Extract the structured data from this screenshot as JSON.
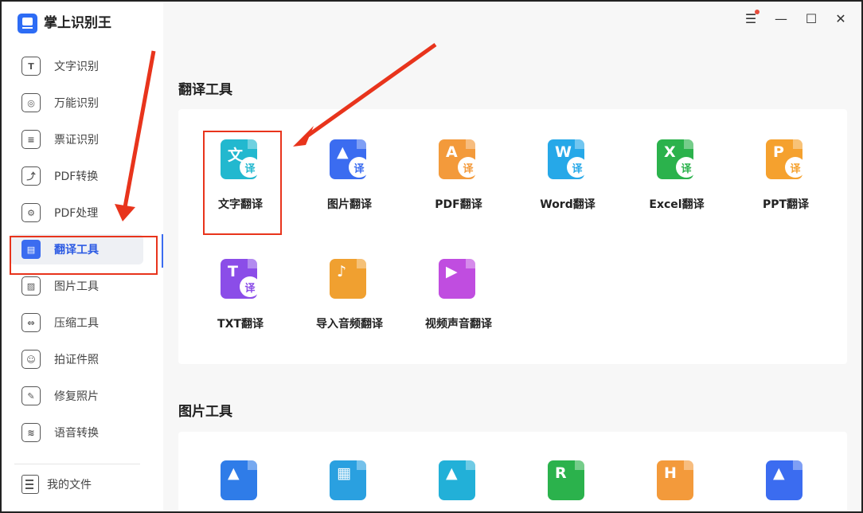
{
  "app": {
    "title": "掌上识别王"
  },
  "sidebar": {
    "items": [
      {
        "label": "文字识别",
        "icon": "text-recognition-icon",
        "glyph": "T"
      },
      {
        "label": "万能识别",
        "icon": "universal-recognition-icon",
        "glyph": "◎"
      },
      {
        "label": "票证识别",
        "icon": "ticket-recognition-icon",
        "glyph": "≡"
      },
      {
        "label": "PDF转换",
        "icon": "pdf-convert-icon",
        "glyph": "⤴"
      },
      {
        "label": "PDF处理",
        "icon": "pdf-process-icon",
        "glyph": "⚙"
      },
      {
        "label": "翻译工具",
        "icon": "translate-tool-icon",
        "glyph": "▤",
        "active": true
      },
      {
        "label": "图片工具",
        "icon": "image-tool-icon",
        "glyph": "▨"
      },
      {
        "label": "压缩工具",
        "icon": "compress-tool-icon",
        "glyph": "⇔"
      },
      {
        "label": "拍证件照",
        "icon": "id-photo-icon",
        "glyph": "☺"
      },
      {
        "label": "修复照片",
        "icon": "repair-photo-icon",
        "glyph": "✎"
      },
      {
        "label": "语音转换",
        "icon": "voice-convert-icon",
        "glyph": "≋"
      }
    ],
    "my_files": "我的文件"
  },
  "window_controls": {
    "menu": "☰",
    "minimize": "—",
    "maximize": "☐",
    "close": "✕"
  },
  "sections": {
    "translate": {
      "title": "翻译工具",
      "tools": [
        {
          "name": "文字翻译",
          "symbol": "文",
          "color": "#22b8cf",
          "badge": "译"
        },
        {
          "name": "图片翻译",
          "symbol": "▲",
          "color": "#3b6cf0",
          "badge": "译"
        },
        {
          "name": "PDF翻译",
          "symbol": "A",
          "color": "#f39a3b",
          "badge": "译"
        },
        {
          "name": "Word翻译",
          "symbol": "W",
          "color": "#26a8e8",
          "badge": "译"
        },
        {
          "name": "Excel翻译",
          "symbol": "X",
          "color": "#2bb24c",
          "badge": "译"
        },
        {
          "name": "PPT翻译",
          "symbol": "P",
          "color": "#f5a12e",
          "badge": "译"
        },
        {
          "name": "TXT翻译",
          "symbol": "T",
          "color": "#8b4de8",
          "badge": "译"
        },
        {
          "name": "导入音频翻译",
          "symbol": "♪",
          "color": "#f0a030",
          "badge": ""
        },
        {
          "name": "视频声音翻译",
          "symbol": "▶",
          "color": "#c04de0",
          "badge": ""
        }
      ]
    },
    "image": {
      "title": "图片工具",
      "tools": [
        {
          "symbol": "▲",
          "color": "#2f7ce8"
        },
        {
          "symbol": "▦",
          "color": "#2aa0e0"
        },
        {
          "symbol": "▲",
          "color": "#22b0d8"
        },
        {
          "symbol": "R",
          "color": "#2bb24c"
        },
        {
          "symbol": "H",
          "color": "#f39a3b"
        },
        {
          "symbol": "▲",
          "color": "#3b6cf0"
        }
      ]
    }
  }
}
